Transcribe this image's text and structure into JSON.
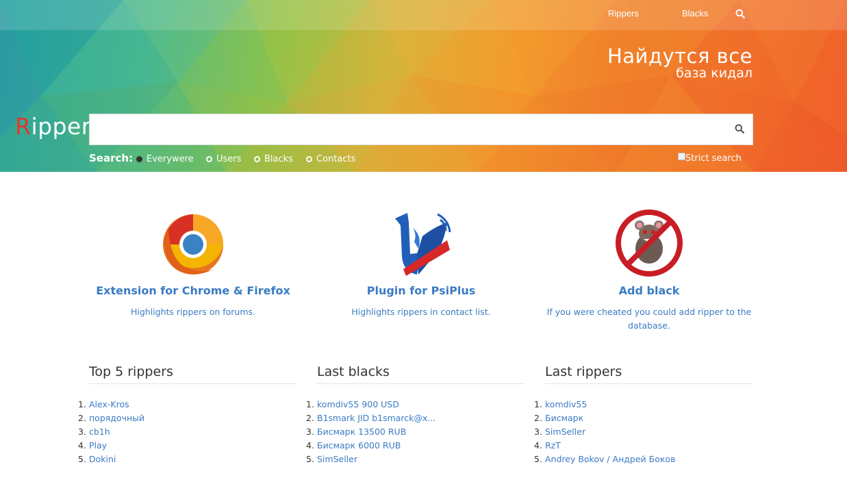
{
  "nav": {
    "rippers_label": "Rippers",
    "blacks_label": "Blacks",
    "search_icon": "search-icon"
  },
  "slogan": {
    "main": "Найдутся все",
    "sub": "база кидал"
  },
  "logo": {
    "first_letter": "R",
    "rest": "ipper"
  },
  "search": {
    "value": "",
    "placeholder": "",
    "label": "Search:",
    "options": [
      {
        "label": "Everywere",
        "selected": true
      },
      {
        "label": "Users",
        "selected": false
      },
      {
        "label": "Blacks",
        "selected": false
      },
      {
        "label": "Contacts",
        "selected": false
      }
    ],
    "strict_label": "Strict search",
    "strict_checked": false
  },
  "features": [
    {
      "icon": "chrome-firefox-icon",
      "title": "Extension for Chrome & Firefox",
      "description": "Highlights rippers on forums."
    },
    {
      "icon": "psiplus-icon",
      "title": "Plugin for PsiPlus",
      "description": "Highlights rippers in contact list."
    },
    {
      "icon": "no-rat-icon",
      "title": "Add black",
      "description": "If you were cheated you could add ripper to the database."
    }
  ],
  "lists": {
    "top": {
      "title": "Top 5 rippers",
      "items": [
        "Alex-Kros",
        "порядочный",
        "cb1h",
        "Play",
        "Dokini"
      ]
    },
    "blacks": {
      "title": "Last blacks",
      "items": [
        "komdiv55 900 USD",
        "B1smark JID b1smarck@x...",
        "Бисмарк 13500 RUB",
        "Бисмарк 6000 RUB",
        "SimSeller"
      ]
    },
    "rippers": {
      "title": "Last rippers",
      "items": [
        "komdiv55",
        "Бисмарк",
        "SimSeller",
        "RzT",
        "Andrey Bokov / Андрей Боков"
      ]
    }
  },
  "colors": {
    "accent": "#3a7bc4",
    "logo_red": "#e8332b",
    "hero_orange": "#f1722a",
    "hero_teal": "#2aa7a0"
  }
}
